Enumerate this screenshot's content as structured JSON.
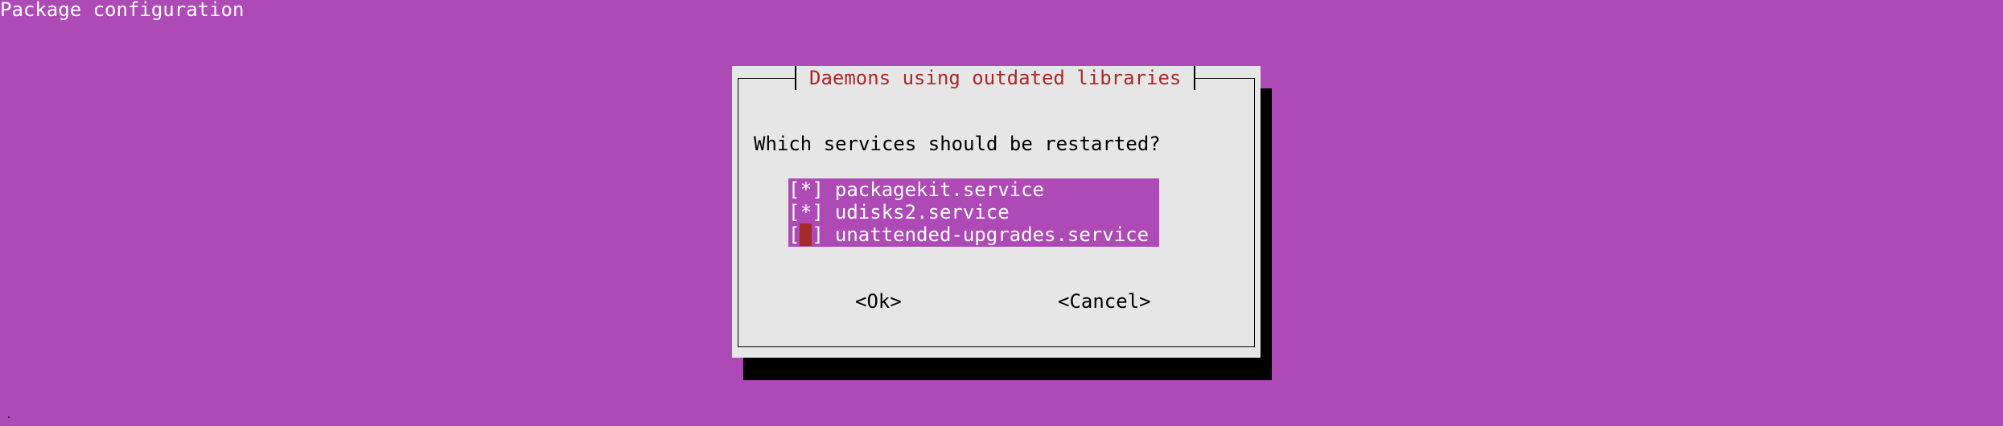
{
  "header": {
    "title": "Package configuration"
  },
  "dialog": {
    "title": "Daemons using outdated libraries",
    "question": "Which services should be restarted?",
    "services": [
      {
        "label": "packagekit.service",
        "mark": "*"
      },
      {
        "label": "udisks2.service",
        "mark": "*"
      },
      {
        "label": "unattended-upgrades.service",
        "mark": " "
      }
    ],
    "ok_label": "<Ok>",
    "cancel_label": "<Cancel>"
  },
  "colors": {
    "background": "#ad4ab6",
    "dialog_bg": "#e6e6e6",
    "title_text": "#a52a2a",
    "cursor": "#a52a2a"
  }
}
